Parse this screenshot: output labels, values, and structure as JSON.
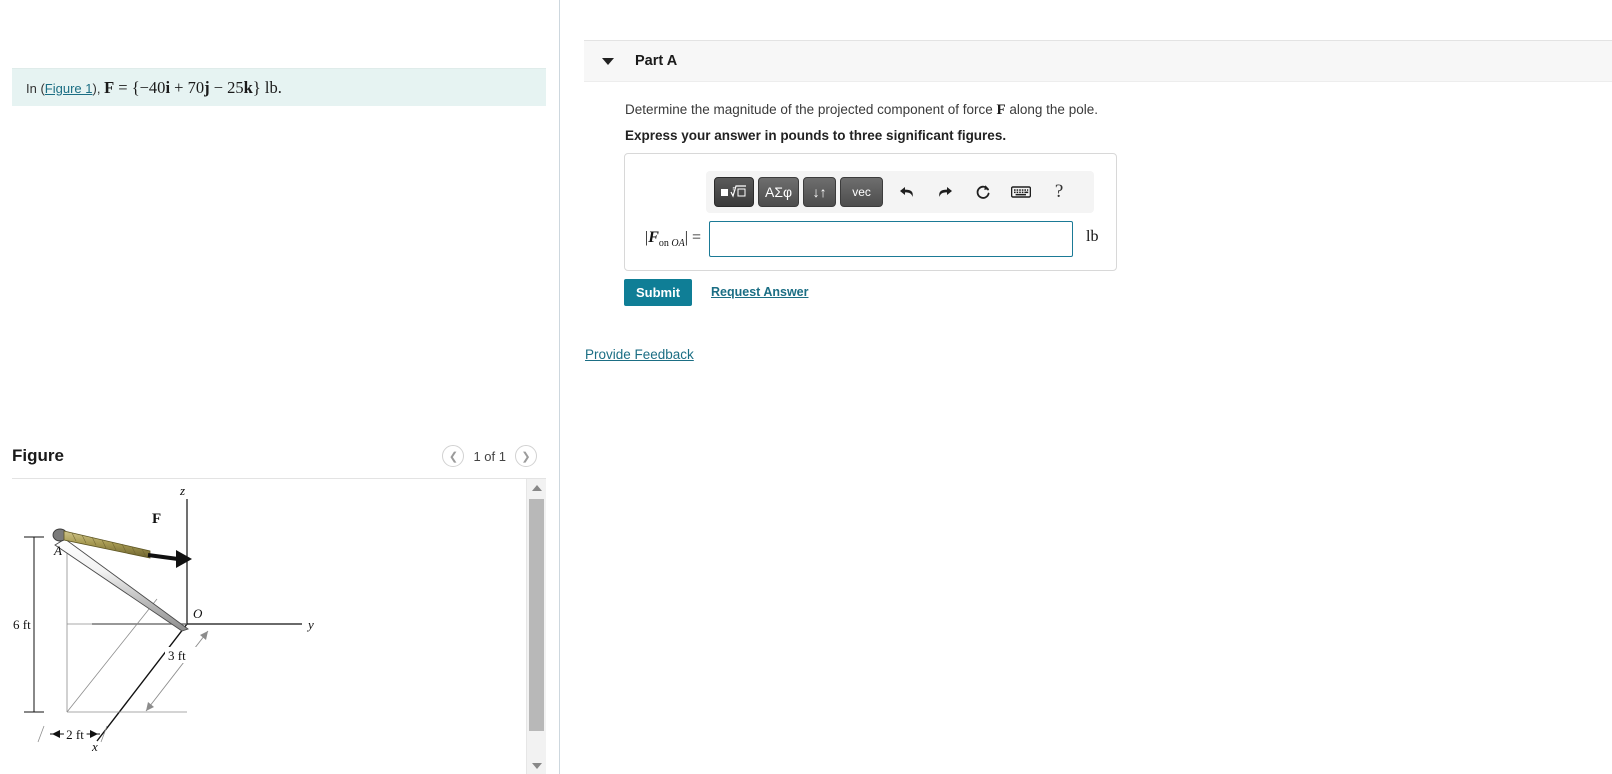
{
  "problem": {
    "prefix": "In (",
    "figure_link": "Figure 1",
    "suffix": "), ",
    "equation": "F = {−40i + 70j − 25k} lb.",
    "background_color": "#e6f3f2"
  },
  "figure": {
    "title": "Figure",
    "count_label": "1 of 1",
    "prev_icon": "chevron-left-icon",
    "next_icon": "chevron-right-icon",
    "diagram": {
      "axis_z": "z",
      "axis_y": "y",
      "axis_x": "x",
      "point_a": "A",
      "point_o": "O",
      "force_label": "F",
      "dim_height": "6 ft",
      "dim_x": "2 ft",
      "dim_y": "3 ft"
    }
  },
  "part": {
    "toggle_icon": "triangle-down-icon",
    "title": "Part A",
    "question_prefix": "Determine the magnitude of the projected component of force ",
    "question_force": "F",
    "question_suffix": " along the pole.",
    "instruction": "Express your answer in pounds to three significant figures."
  },
  "toolbar": {
    "buttons": [
      {
        "name": "template-sqrt-button",
        "label": "■√□",
        "icon": "math-template-icon"
      },
      {
        "name": "greek-symbols-button",
        "label": "ΑΣφ",
        "icon": "greek-letters-icon"
      },
      {
        "name": "subscript-superscript-button",
        "label": "↓↑",
        "icon": "sub-sup-icon"
      },
      {
        "name": "vector-button",
        "label": "vec",
        "icon": "vector-icon"
      }
    ],
    "plain_icons": [
      {
        "name": "undo-icon",
        "glyph": "↶"
      },
      {
        "name": "redo-icon",
        "glyph": "↷"
      },
      {
        "name": "reset-icon",
        "glyph": "↻"
      },
      {
        "name": "keyboard-icon",
        "glyph": "⌨"
      },
      {
        "name": "help-icon",
        "glyph": "?"
      }
    ]
  },
  "answer": {
    "label": "|F on OA| =",
    "label_main": "F",
    "label_sub": "on OA",
    "value": "",
    "placeholder": "",
    "unit": "lb",
    "border_color": "#1b7a96"
  },
  "actions": {
    "submit_label": "Submit",
    "submit_color": "#0f7e96",
    "request_answer_label": "Request Answer",
    "provide_feedback_label": "Provide Feedback",
    "link_color": "#1b6e84"
  },
  "scrollbar": {
    "up_icon": "scroll-up-arrow-icon",
    "down_icon": "scroll-down-arrow-icon"
  }
}
